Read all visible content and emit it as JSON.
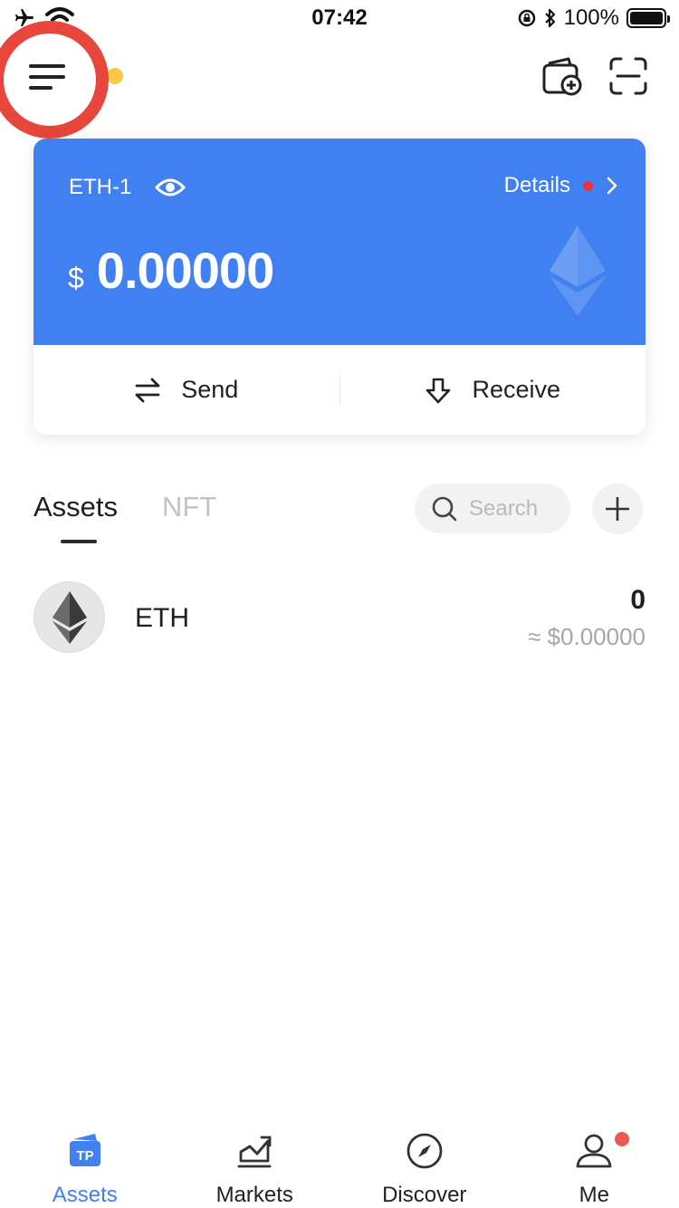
{
  "status_bar": {
    "time": "07:42",
    "battery_percent_label": "100%",
    "battery_level": 1.0
  },
  "header": {
    "menu_icon": "menu-icon",
    "wallet_add_icon": "wallet-add-icon",
    "scan_icon": "scan-icon"
  },
  "wallet": {
    "name": "ETH-1",
    "details_label": "Details",
    "currency_symbol": "$",
    "balance": "0.00000",
    "send_label": "Send",
    "receive_label": "Receive"
  },
  "tabs": {
    "assets_label": "Assets",
    "nft_label": "NFT",
    "search_placeholder": "Search"
  },
  "assets": [
    {
      "symbol": "ETH",
      "amount": "0",
      "fiat_value": "≈ $0.00000"
    }
  ],
  "bottom_nav": [
    {
      "label": "Assets",
      "icon": "tp-wallet-icon",
      "active": true
    },
    {
      "label": "Markets",
      "icon": "markets-chart-icon",
      "active": false
    },
    {
      "label": "Discover",
      "icon": "compass-icon",
      "active": false
    },
    {
      "label": "Me",
      "icon": "user-icon",
      "active": false
    }
  ],
  "colors": {
    "brand_blue": "#4080f0",
    "highlight_red": "#e8453c",
    "notification_yellow": "#f7c948",
    "notification_red": "#e8333a"
  }
}
